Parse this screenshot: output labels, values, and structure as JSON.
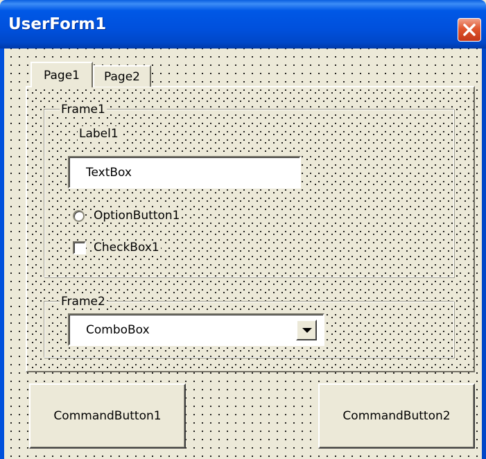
{
  "window": {
    "title": "UserForm1",
    "close_icon": "close-icon"
  },
  "multipage": {
    "tabs": [
      {
        "label": "Page1",
        "selected": true
      },
      {
        "label": "Page2",
        "selected": false
      }
    ]
  },
  "frame1": {
    "caption": "Frame1",
    "label": "Label1",
    "textbox_value": "TextBox",
    "option_button_label": "OptionButton1",
    "checkbox_label": "CheckBox1"
  },
  "frame2": {
    "caption": "Frame2",
    "combobox_value": "ComboBox",
    "combobox_arrow_icon": "chevron-down-icon"
  },
  "buttons": {
    "command1": "CommandButton1",
    "command2": "CommandButton2"
  },
  "colors": {
    "titlebar": "#0054e3",
    "face": "#ece9d8",
    "close_button": "#e0562e"
  }
}
